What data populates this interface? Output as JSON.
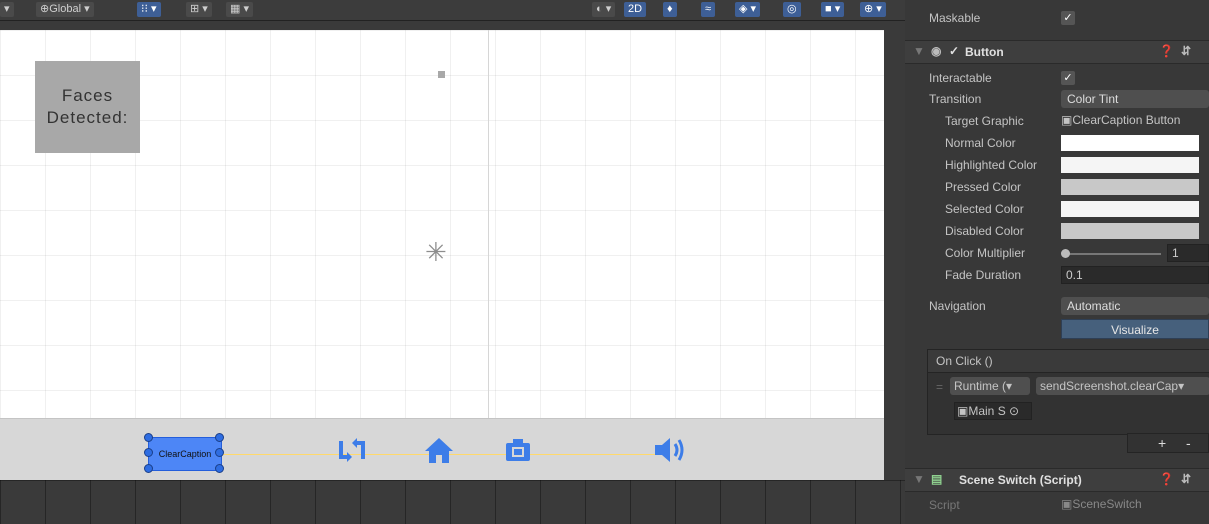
{
  "toolbar": {
    "global_label": "Global",
    "twod_label": "2D"
  },
  "canvas": {
    "faces_line1": "Faces",
    "faces_line2": "Detected:",
    "center_mark": "✳",
    "clear_caption_label": "ClearCaption"
  },
  "icons": {
    "switch": "swap-icon",
    "home": "home-icon",
    "camera": "camera-icon",
    "volume": "volume-icon"
  },
  "inspector": {
    "maskable_label": "Maskable",
    "maskable_checked": "✓",
    "button_header": "Button",
    "interactable_label": "Interactable",
    "interactable_checked": "✓",
    "transition_label": "Transition",
    "transition_value": "Color Tint",
    "target_graphic_label": "Target Graphic",
    "target_graphic_value": "ClearCaption Button",
    "normal_color_label": "Normal Color",
    "highlighted_color_label": "Highlighted Color",
    "pressed_color_label": "Pressed Color",
    "selected_color_label": "Selected Color",
    "disabled_color_label": "Disabled Color",
    "color_multiplier_label": "Color Multiplier",
    "color_multiplier_value": "1",
    "fade_duration_label": "Fade Duration",
    "fade_duration_value": "0.1",
    "navigation_label": "Navigation",
    "navigation_value": "Automatic",
    "visualize_label": "Visualize",
    "onclick_label": "On Click ()",
    "runtime_label": "Runtime (",
    "function_value": "sendScreenshot.clearCap",
    "object_value": "Main S",
    "plus": "+",
    "minus": "-",
    "scene_switch_header": "Scene Switch (Script)",
    "script_label": "Script",
    "script_value": "SceneSwitch"
  },
  "colors": {
    "normal": "#ffffff",
    "highlighted": "#f5f5f5",
    "pressed": "#c8c8c8",
    "selected": "#f5f5f5",
    "disabled": "#c8c8c8"
  }
}
